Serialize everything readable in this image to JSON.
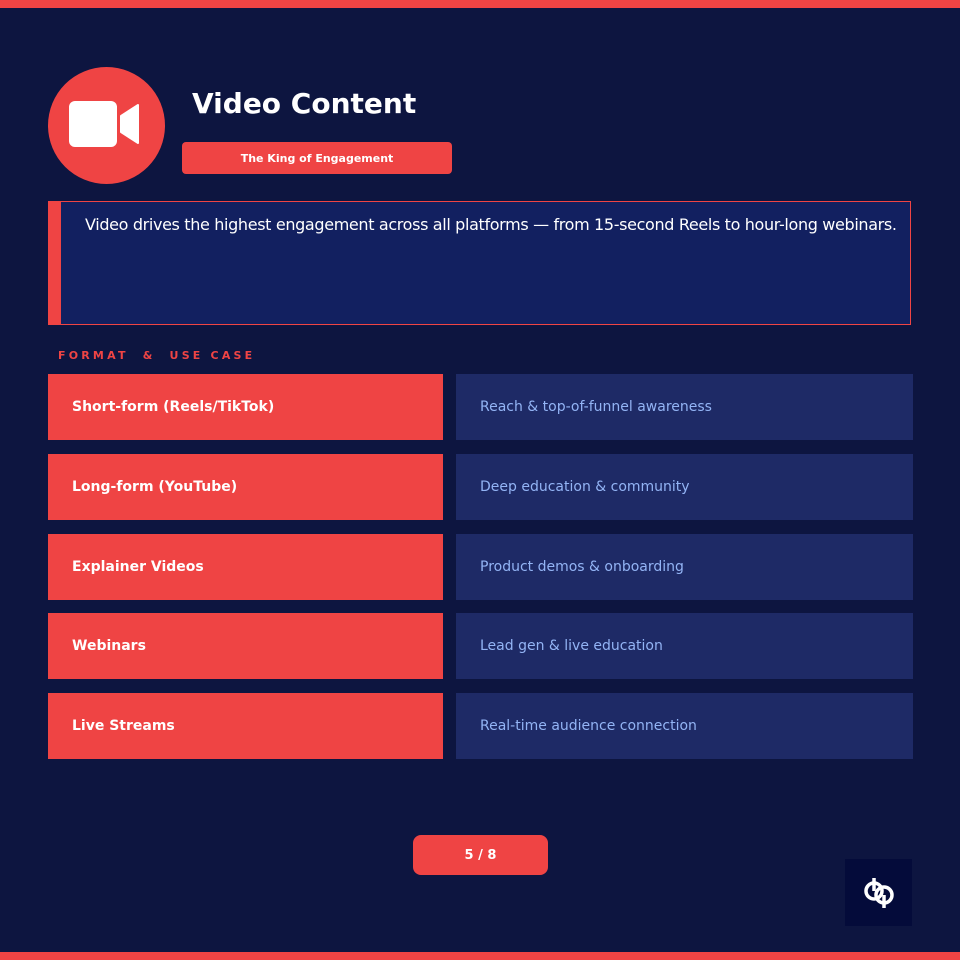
{
  "header": {
    "title": "Video Content",
    "subtitle": "The King of Engagement",
    "icon": "video-camera-icon"
  },
  "intro": {
    "text": "Video drives the highest engagement across all platforms — from 15-second Reels to hour-long webinars."
  },
  "section": {
    "label": "FORMAT  &  USE CASE"
  },
  "rows": [
    {
      "format": "Short-form (Reels/TikTok)",
      "use_case": "Reach & top-of-funnel awareness"
    },
    {
      "format": "Long-form (YouTube)",
      "use_case": "Deep education & community"
    },
    {
      "format": "Explainer Videos",
      "use_case": "Product demos & onboarding"
    },
    {
      "format": "Webinars",
      "use_case": "Lead gen & live education"
    },
    {
      "format": "Live Streams",
      "use_case": "Real-time audience connection"
    }
  ],
  "footer": {
    "page_indicator": "5 / 8",
    "logo": "brand-logo-icon"
  },
  "colors": {
    "background": "#0d1540",
    "accent": "#ef4444",
    "panel": "#1e2a66",
    "muted_text": "#93b4f5"
  }
}
